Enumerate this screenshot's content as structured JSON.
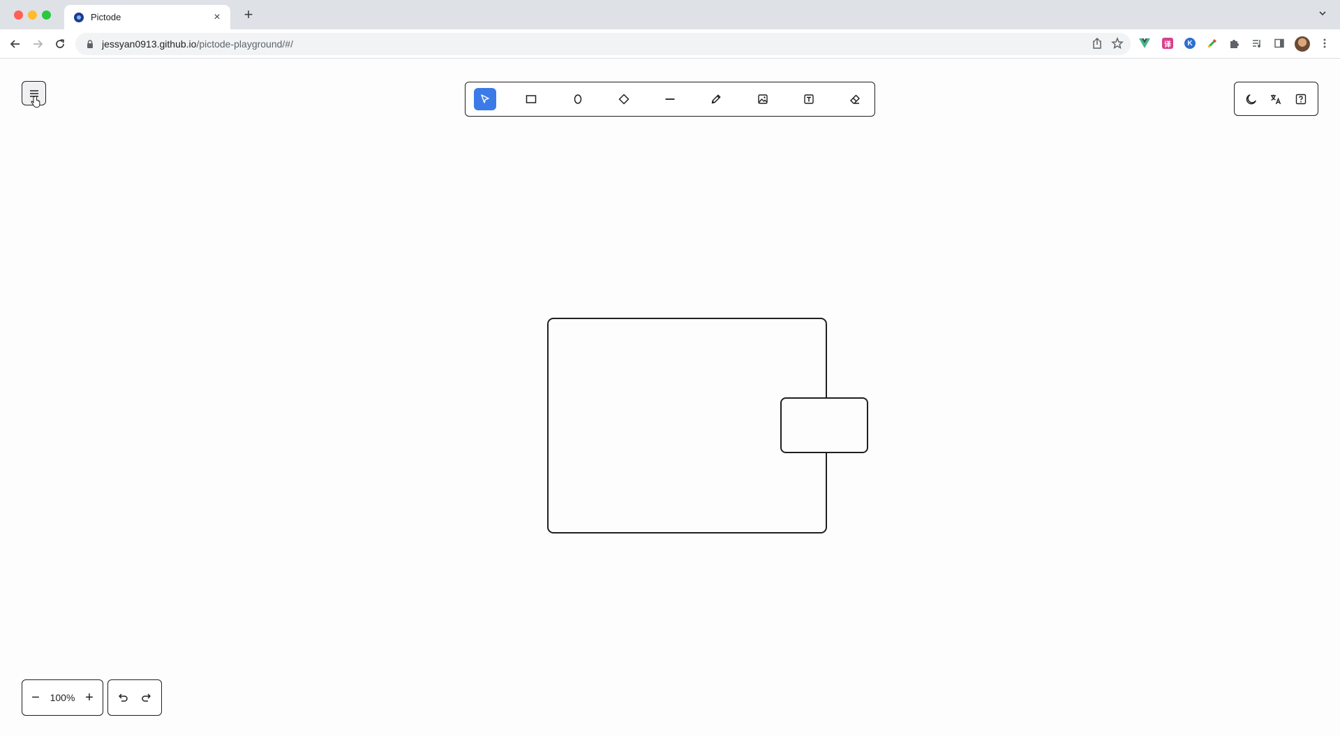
{
  "browser": {
    "tab_title": "Pictode",
    "tab_close": "×",
    "new_tab": "+",
    "url_host": "jessyan0913.github.io",
    "url_path": "/pictode-playground/#/"
  },
  "extensions": [
    {
      "name": "vue-devtools",
      "color": "#2e9e6e",
      "glyph": "▼"
    },
    {
      "name": "translate",
      "color": "#d9418b",
      "glyph": "译"
    },
    {
      "name": "k-extension",
      "color": "#2f6fd1",
      "glyph": "K"
    },
    {
      "name": "color-picker",
      "color": "#e8453c",
      "glyph": ""
    }
  ],
  "app": {
    "toolbar": {
      "active_tool": "select",
      "tools": [
        "select",
        "rectangle",
        "ellipse",
        "diamond",
        "line",
        "pencil",
        "image",
        "text",
        "eraser"
      ]
    },
    "zoom": {
      "minus": "−",
      "level": "100%",
      "plus": "+"
    },
    "canvas": {
      "shapes": [
        {
          "type": "rectangle",
          "name": "large-rectangle"
        },
        {
          "type": "rectangle",
          "name": "small-rectangle"
        }
      ]
    },
    "colors": {
      "accent": "#3b7be8",
      "stroke": "#1f1f1f",
      "background": "#fdfdfd"
    }
  }
}
